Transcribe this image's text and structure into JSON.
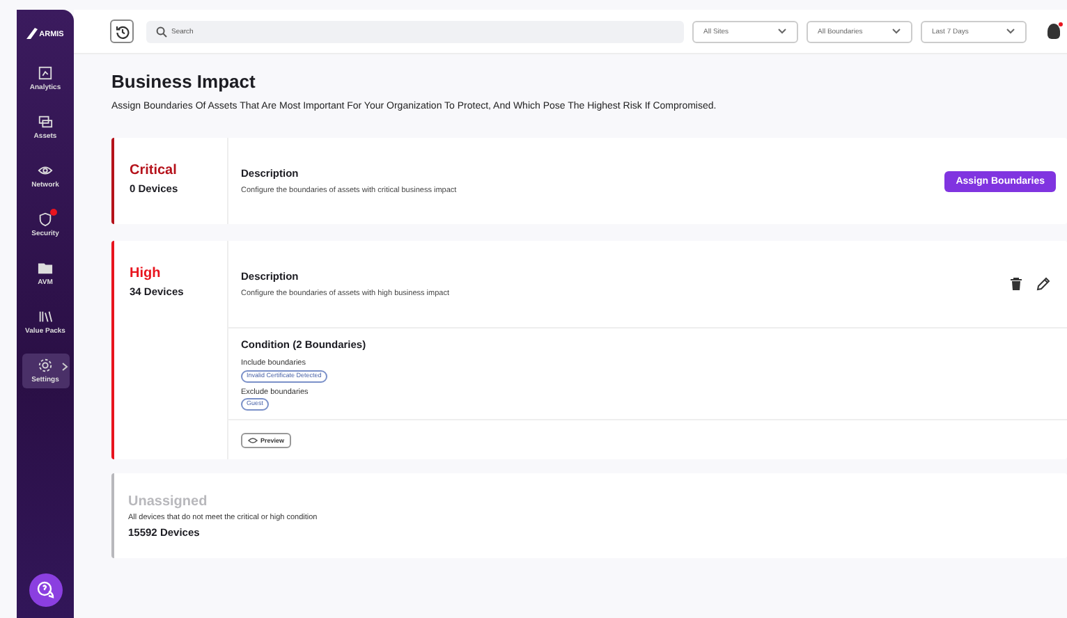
{
  "sidebar": {
    "logo": "ARMIS",
    "items": [
      {
        "label": "Analytics",
        "selected": false,
        "badge": false
      },
      {
        "label": "Assets",
        "selected": false,
        "badge": false
      },
      {
        "label": "Network",
        "selected": false,
        "badge": false
      },
      {
        "label": "Security",
        "selected": false,
        "badge": true
      },
      {
        "label": "AVM",
        "selected": false,
        "badge": false
      },
      {
        "label": "Value Packs",
        "selected": false,
        "badge": false
      },
      {
        "label": "Settings",
        "selected": true,
        "badge": false
      }
    ]
  },
  "topbar": {
    "search": {
      "placeholder": "Search"
    },
    "filters": [
      "All Sites",
      "All Boundaries",
      "Last 7 Days"
    ]
  },
  "page": {
    "title": "Business Impact",
    "subtitle": "Assign Boundaries Of Assets That Are Most Important For Your Organization To Protect, And Which Pose The Highest Risk If Compromised."
  },
  "impacts": [
    {
      "kind": "tier",
      "name": "Critical",
      "color": "#b5121b",
      "devices": "0 Devices",
      "description_title": "Description",
      "description": "Configure the boundaries of assets with critical business impact",
      "action": "Assign Boundaries"
    },
    {
      "kind": "tier",
      "name": "High",
      "color": "#e8141e",
      "devices": "34 Devices",
      "description_title": "Description",
      "description": "Configure the boundaries of assets with high business impact",
      "condition": {
        "title": "Condition (2 Boundaries)",
        "groups": [
          {
            "label": "Include boundaries",
            "tags": [
              "Invalid Certificate Detected"
            ]
          },
          {
            "label": "Exclude boundaries",
            "tags": [
              "Guest"
            ]
          }
        ]
      },
      "preview": "Preview"
    },
    {
      "kind": "unassigned",
      "name": "Unassigned",
      "color": "#b8b8bc",
      "description": "All devices that do not meet the critical or high condition",
      "devices": "15592 Devices"
    }
  ]
}
